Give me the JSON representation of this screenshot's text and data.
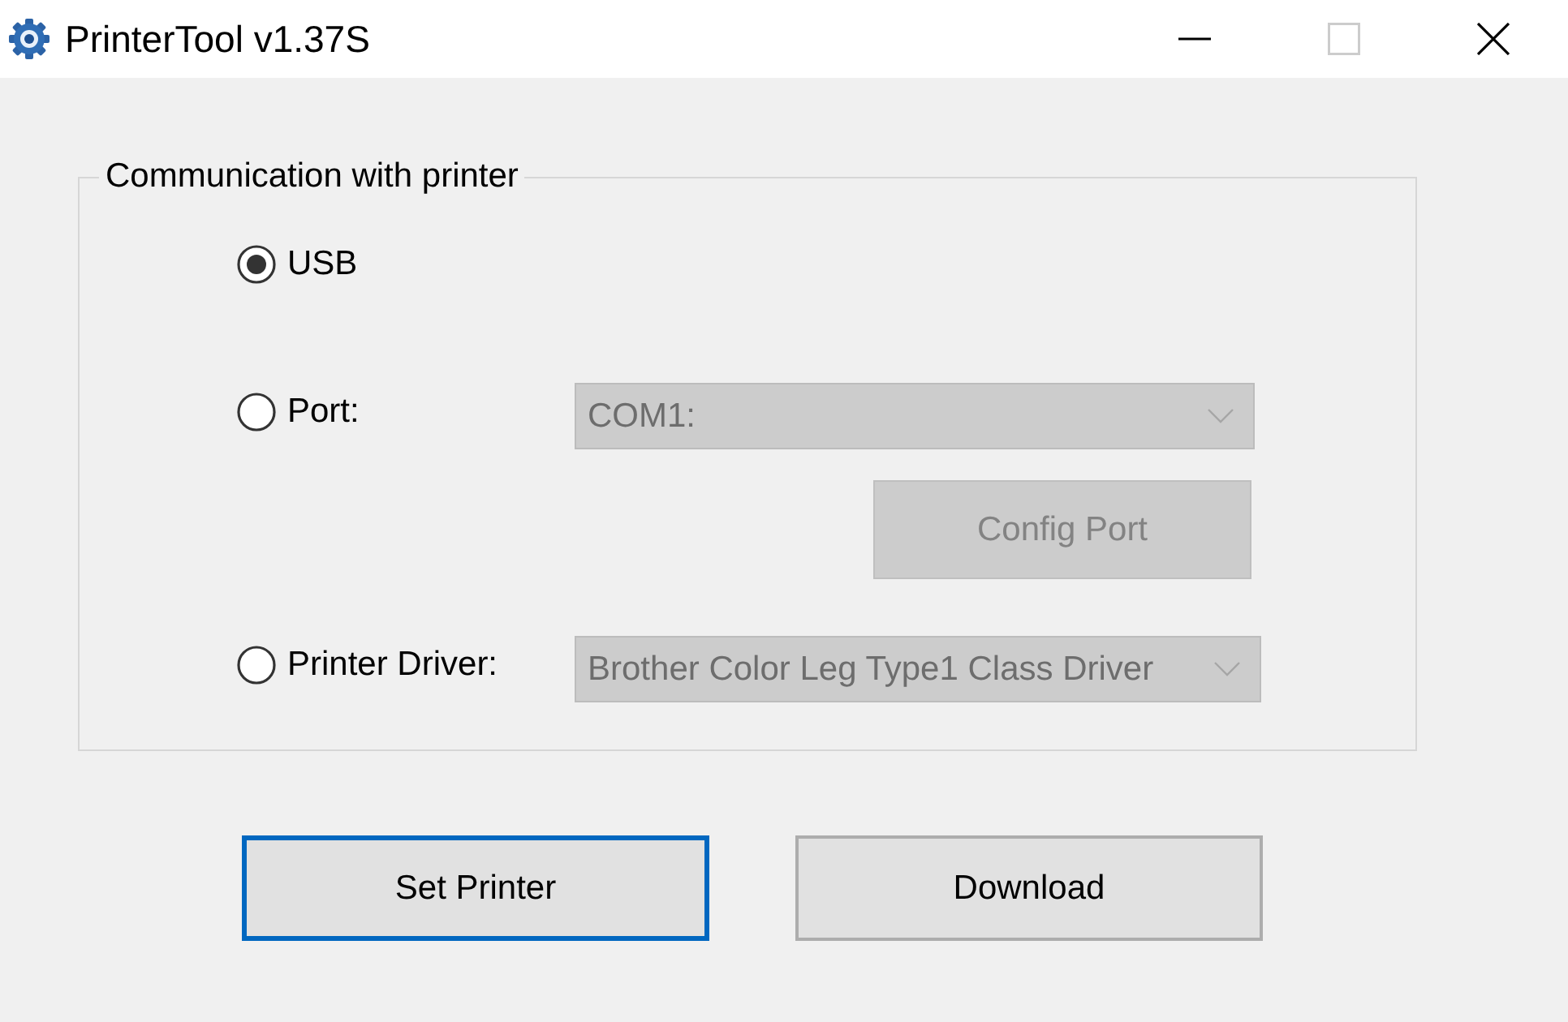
{
  "window": {
    "title": "PrinterTool v1.37S",
    "controls": [
      {
        "kind": "minimize",
        "disabled": false
      },
      {
        "kind": "maximize",
        "disabled": true
      },
      {
        "kind": "close",
        "disabled": false
      }
    ]
  },
  "communication": {
    "title": "Communication with printer",
    "options": [
      {
        "label": "USB",
        "selected": true
      },
      {
        "label": "Port:",
        "selected": false,
        "dropdown": {
          "value": "COM1:",
          "disabled": true
        },
        "button": {
          "label": "Config Port",
          "disabled": true
        }
      },
      {
        "label": "Printer Driver:",
        "selected": false,
        "dropdown": {
          "value": "Brother Color Leg Type1 Class Driver",
          "disabled": true
        }
      }
    ]
  },
  "buttons": [
    {
      "label": "Set Printer",
      "focused": true
    },
    {
      "label": "Download",
      "focused": false
    }
  ]
}
